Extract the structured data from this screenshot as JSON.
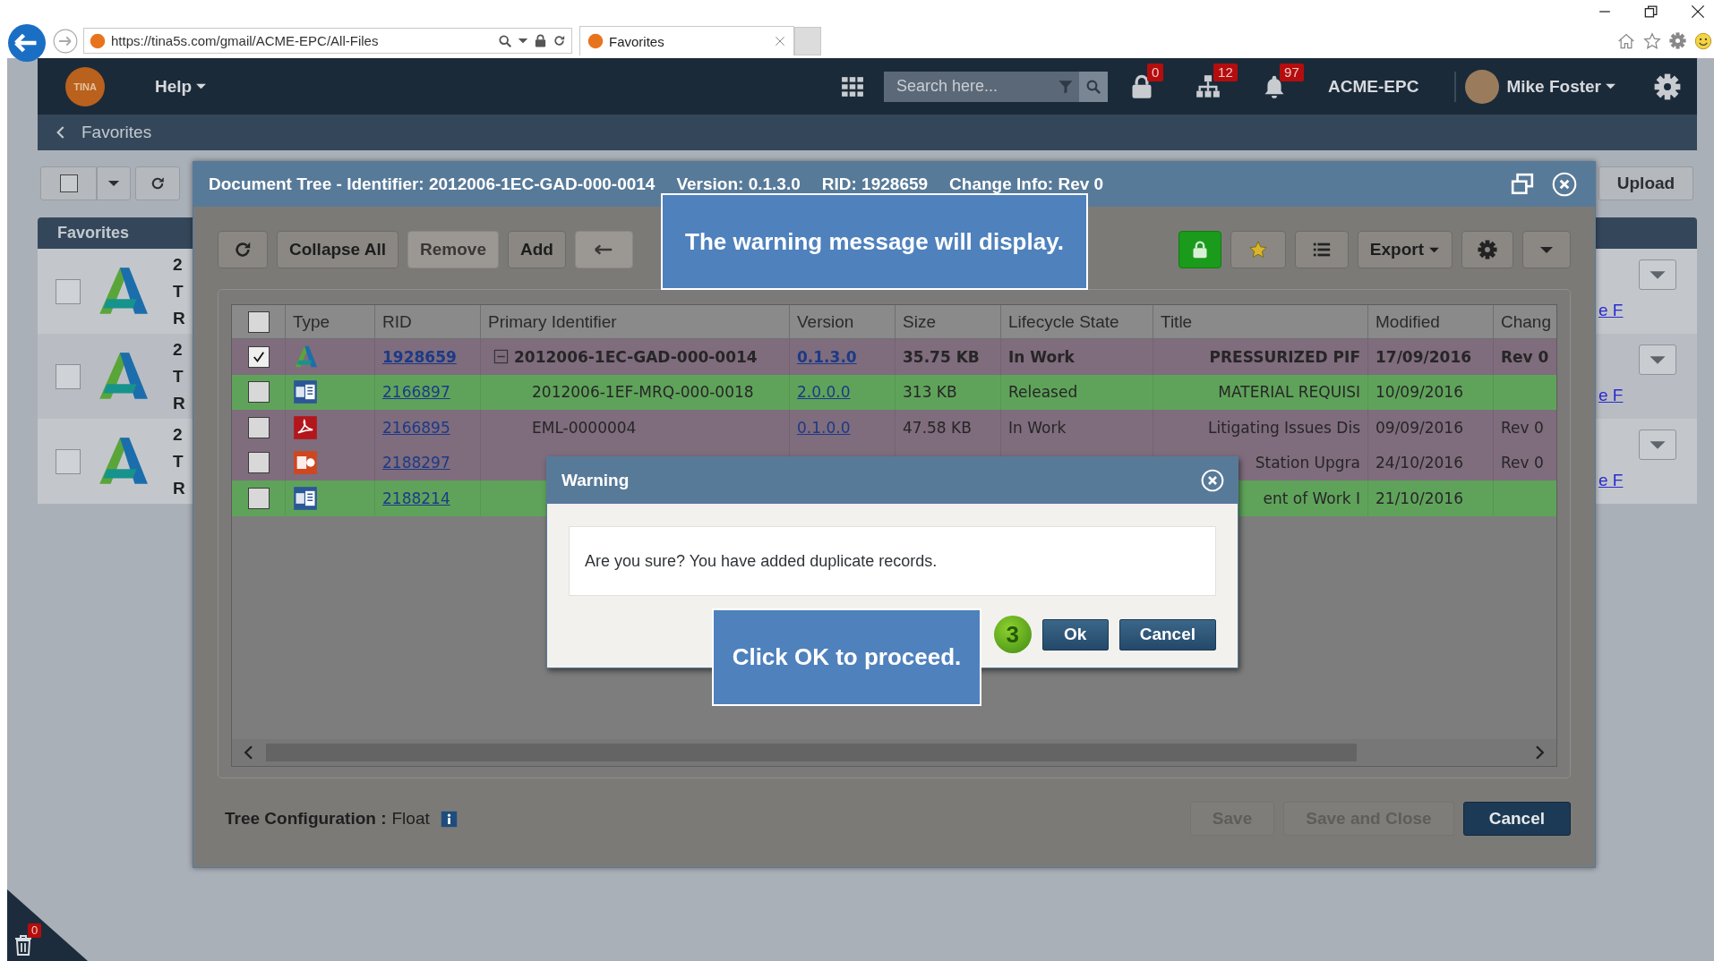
{
  "browser": {
    "url": "https://tina5s.com/gmail/ACME-EPC/All-Files",
    "tab_title": "Favorites"
  },
  "app_header": {
    "logo": "TINA",
    "help": "Help",
    "search_placeholder": "Search here...",
    "badges": [
      {
        "kind": "lock",
        "count": "0"
      },
      {
        "kind": "hierarchy",
        "count": "12"
      },
      {
        "kind": "bell",
        "count": "97"
      }
    ],
    "company": "ACME-EPC",
    "user": "Mike Foster"
  },
  "breadcrumb": "Favorites",
  "background_page": {
    "favorites_title": "Favorites",
    "upload": "Upload",
    "favorites": [
      {
        "checked": false,
        "lines": [
          "2",
          "T",
          "R"
        ],
        "link": "e F"
      },
      {
        "checked": false,
        "lines": [
          "2",
          "T",
          "R"
        ],
        "link": "e F"
      },
      {
        "checked": false,
        "lines": [
          "2",
          "T",
          "R"
        ],
        "link": "e F"
      }
    ]
  },
  "document_tree": {
    "title_parts": [
      "Document Tree - Identifier: 2012006-1EC-GAD-000-0014",
      "Version: 0.1.3.0",
      "RID: 1928659",
      "Change Info: Rev 0"
    ],
    "toolbar_left": [
      {
        "kind": "refresh",
        "disabled": false
      },
      {
        "kind": "text",
        "label": "Collapse All",
        "disabled": false
      },
      {
        "kind": "text",
        "label": "Remove",
        "disabled": true
      },
      {
        "kind": "text",
        "label": "Add",
        "disabled": false
      },
      {
        "kind": "back",
        "disabled": true
      }
    ],
    "toolbar_right": [
      {
        "kind": "lock",
        "disabled": false
      },
      {
        "kind": "star",
        "disabled": false
      },
      {
        "kind": "list",
        "disabled": false
      },
      {
        "kind": "dropdown",
        "label": "Export",
        "disabled": false
      },
      {
        "kind": "gear",
        "disabled": false
      },
      {
        "kind": "caret",
        "disabled": false
      }
    ],
    "table": {
      "header_checked": false,
      "columns": [
        "Type",
        "RID",
        "Primary Identifier",
        "Version",
        "Size",
        "Lifecycle State",
        "Title",
        "Modified",
        "Chang"
      ],
      "rows": [
        {
          "kind": "drawing",
          "checked": true,
          "expanded": true,
          "color": "#7f6c7d",
          "rid": "1928659",
          "primary_identifier": "2012006-1EC-GAD-000-0014",
          "version": "0.1.3.0",
          "size": "35.75 KB",
          "lifecycle_state": "In Work",
          "title": "PRESSURIZED PIF",
          "modified": "17/09/2016",
          "change": "Rev 0",
          "children": [
            {
              "kind": "word",
              "checked": false,
              "color": "#5fa35b",
              "rid": "2166897",
              "primary_identifier": "2012006-1EF-MRQ-000-0018",
              "version": "2.0.0.0",
              "size": "313 KB",
              "lifecycle_state": "Released",
              "title": "MATERIAL REQUISI",
              "modified": "10/09/2016"
            },
            {
              "kind": "pdf",
              "checked": false,
              "color": "#7f6c7d",
              "rid": "2166895",
              "primary_identifier": "EML-0000004",
              "version": "0.1.0.0",
              "size": "47.58 KB",
              "lifecycle_state": "In Work",
              "title": "Litigating Issues Dis",
              "modified": "09/09/2016",
              "change": "Rev 0"
            },
            {
              "kind": "powerpoint",
              "checked": false,
              "color": "#7f6c7d",
              "rid": "2188297",
              "title": "Station Upgra",
              "modified": "24/10/2016",
              "change": "Rev 0"
            },
            {
              "kind": "word",
              "checked": false,
              "color": "#5fa35b",
              "rid": "2188214",
              "title": "ent of Work I",
              "modified": "21/10/2016"
            }
          ]
        }
      ]
    },
    "footer": {
      "label": "Tree Configuration :",
      "value": "Float",
      "buttons": [
        {
          "label": "Save",
          "kind": "default",
          "disabled": true
        },
        {
          "label": "Save and Close",
          "kind": "default",
          "disabled": true
        },
        {
          "label": "Cancel",
          "kind": "primary",
          "disabled": false
        }
      ]
    }
  },
  "warning": {
    "title": "Warning",
    "message": "Are you sure? You have added duplicate records.",
    "step": "3",
    "buttons": [
      "Ok",
      "Cancel"
    ]
  },
  "callouts": [
    {
      "text": "The warning message will display."
    },
    {
      "text": "Click OK to proceed."
    }
  ],
  "trash": {
    "count": "0"
  }
}
